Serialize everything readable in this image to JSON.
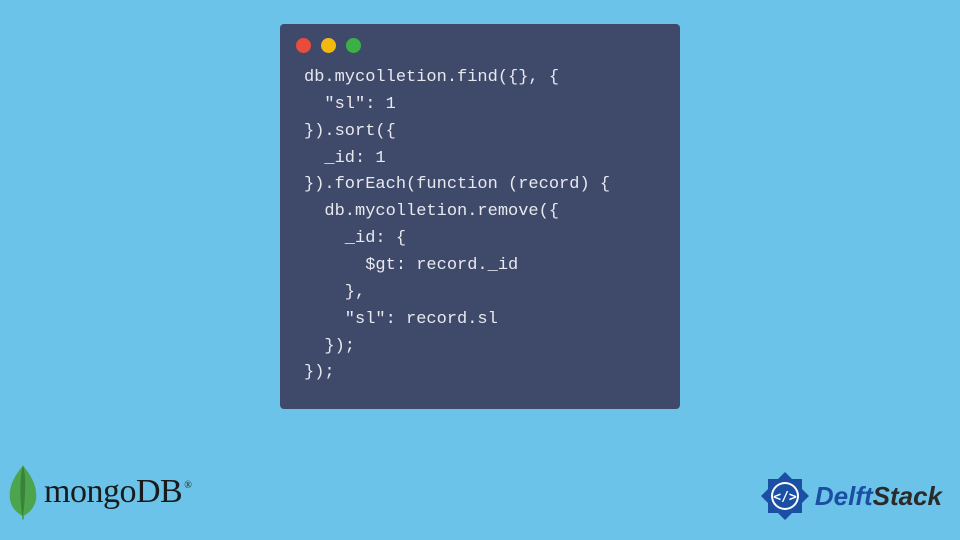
{
  "code_lines": [
    "db.mycolletion.find({}, {",
    "  \"sl\": 1",
    "}).sort({",
    "  _id: 1",
    "}).forEach(function (record) {",
    "  db.mycolletion.remove({",
    "    _id: {",
    "      $gt: record._id",
    "    },",
    "    \"sl\": record.sl",
    "  });",
    "});"
  ],
  "traffic": {
    "red": "#e94b3c",
    "yellow": "#f2b90f",
    "green": "#3bb044"
  },
  "mongo": {
    "text": "mongoDB",
    "mark": "®"
  },
  "delft": {
    "part1": "Delft",
    "part2": "Stack"
  }
}
